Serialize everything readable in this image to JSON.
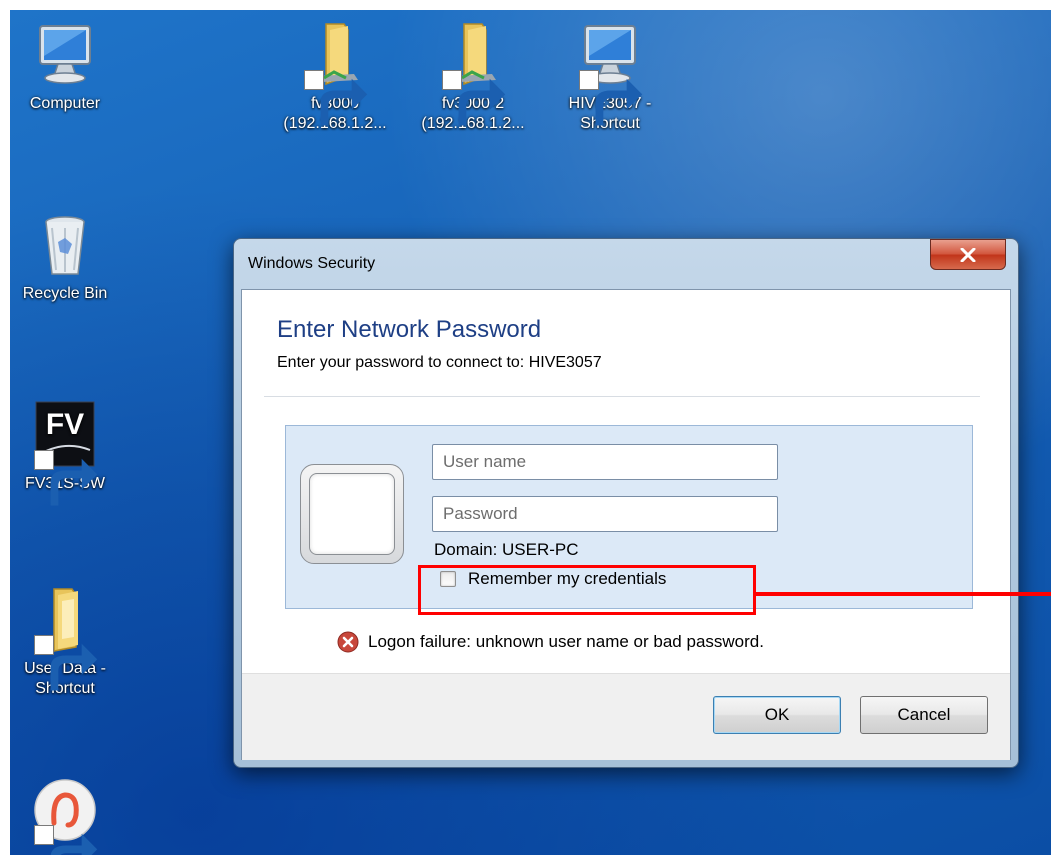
{
  "desktop": {
    "icons": [
      {
        "label": "Computer",
        "icon": "computer-monitor-icon"
      },
      {
        "label": "fv3000\n(192.168.1.2...",
        "icon": "network-folder-icon"
      },
      {
        "label": "fv3000-2\n(192.168.1.2...",
        "icon": "network-folder-icon"
      },
      {
        "label": "HIVE3057 -\nShortcut",
        "icon": "computer-monitor-icon"
      },
      {
        "label": "Recycle Bin",
        "icon": "recycle-bin-icon"
      },
      {
        "label": "FV31S-SW",
        "icon": "fv-app-icon",
        "logo_text": "FV"
      },
      {
        "label": "User Data -\nShortcut",
        "icon": "folder-icon"
      },
      {
        "label": "",
        "icon": "app-circle-icon"
      }
    ]
  },
  "dialog": {
    "title": "Windows Security",
    "heading": "Enter Network Password",
    "subtext": "Enter your password to connect to: HIVE3057",
    "username_placeholder": "User name",
    "password_placeholder": "Password",
    "domain": "Domain: USER-PC",
    "remember_label": "Remember my credentials",
    "remember_checked": false,
    "error": "Logon failure: unknown user name or bad password.",
    "ok_label": "OK",
    "cancel_label": "Cancel"
  },
  "colors": {
    "desktop_blue": "#1560b5",
    "heading_blue": "#1e3f85",
    "close_red": "#c1351a",
    "annotation_red": "#ff0000"
  }
}
